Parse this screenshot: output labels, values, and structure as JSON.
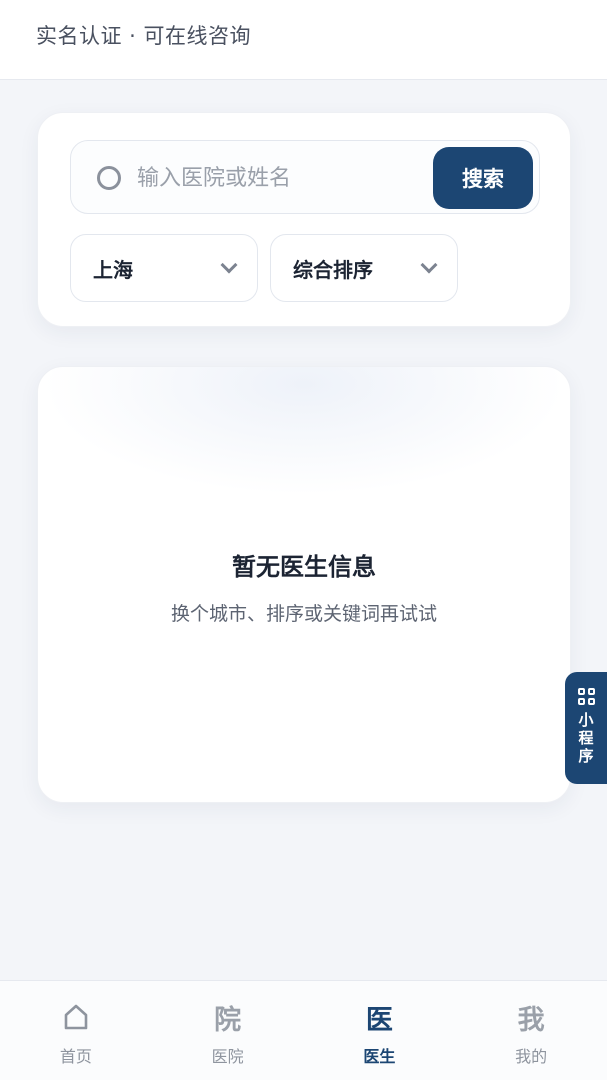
{
  "header": {
    "subtitle": "实名认证 · 可在线咨询"
  },
  "search": {
    "placeholder": "输入医院或姓名",
    "value": "",
    "button_label": "搜索"
  },
  "filters": {
    "city": "上海",
    "sort": "综合排序"
  },
  "empty_state": {
    "title": "暂无医生信息",
    "description": "换个城市、排序或关键词再试试"
  },
  "mini_program": {
    "label": "小程序",
    "icon": "qr-grid-icon"
  },
  "tabbar": {
    "active": "doctor",
    "tabs": [
      {
        "key": "home",
        "icon": "home-icon",
        "glyph": "",
        "label": "首页"
      },
      {
        "key": "hospital",
        "icon": "hospital-glyph-icon",
        "glyph": "院",
        "label": "医院"
      },
      {
        "key": "doctor",
        "icon": "doctor-glyph-icon",
        "glyph": "医",
        "label": "医生"
      },
      {
        "key": "mine",
        "icon": "mine-glyph-icon",
        "glyph": "我",
        "label": "我的"
      }
    ]
  },
  "colors": {
    "primary": "#1c4673",
    "background": "#f3f5f9",
    "card": "#ffffff",
    "muted_text": "#8e949e"
  }
}
